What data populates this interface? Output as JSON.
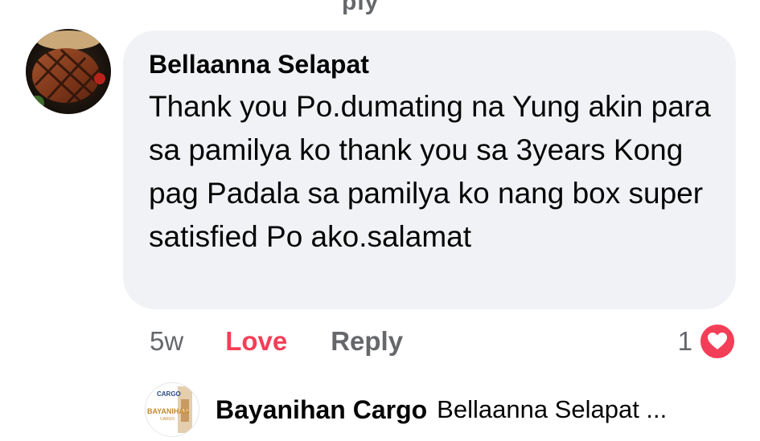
{
  "top_fragment": "ply",
  "comment": {
    "author": "Bellaanna Selapat",
    "text": "Thank you Po.dumating na Yung akin para sa pamilya ko thank you sa 3years Kong pag Padala sa pamilya ko nang box super satisfied Po ako.salamat",
    "avatar_icon": "steak-photo-avatar",
    "bubble_color": "#f0f2f5"
  },
  "actions": {
    "age": "5w",
    "love_label": "Love",
    "reply_label": "Reply",
    "love_color": "#f33e58"
  },
  "reactions": {
    "count": "1",
    "icon": "heart-icon"
  },
  "reply": {
    "author": "Bayanihan Cargo",
    "snippet": "Bellaanna Selapat ...",
    "logo_text": "BAYANIHAN",
    "logo_sub": "CARGO"
  }
}
